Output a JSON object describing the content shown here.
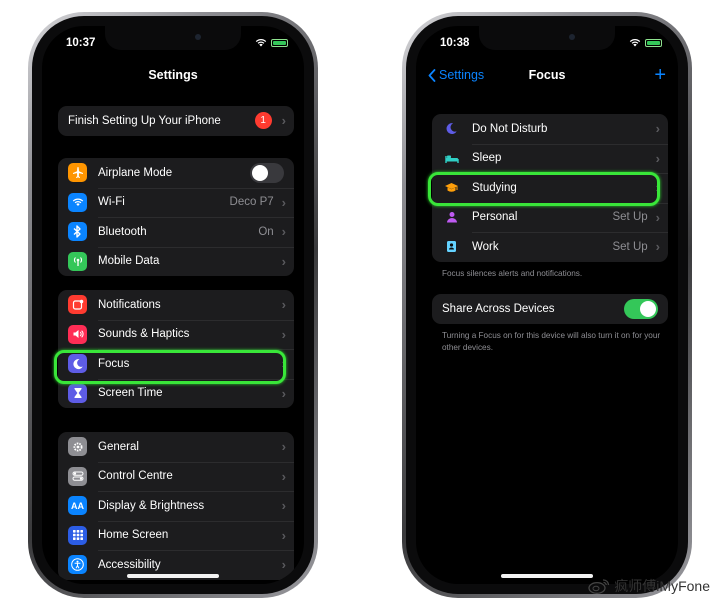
{
  "left_phone": {
    "time": "10:37",
    "title": "Settings",
    "setup": {
      "label": "Finish Setting Up Your iPhone",
      "badge": "1"
    },
    "group1": [
      {
        "name": "airplane",
        "label": "Airplane Mode",
        "icon": "airplane-icon",
        "color": "#ff9500",
        "toggle": false
      },
      {
        "name": "wifi",
        "label": "Wi-Fi",
        "value": "Deco P7",
        "icon": "wifi-icon",
        "color": "#0a84ff"
      },
      {
        "name": "bluetooth",
        "label": "Bluetooth",
        "value": "On",
        "icon": "bluetooth-icon",
        "color": "#0a84ff"
      },
      {
        "name": "mobile-data",
        "label": "Mobile Data",
        "icon": "antenna-icon",
        "color": "#34c759"
      }
    ],
    "group2": [
      {
        "name": "notifications",
        "label": "Notifications",
        "icon": "notifications-icon",
        "color": "#ff3b30"
      },
      {
        "name": "sounds",
        "label": "Sounds & Haptics",
        "icon": "speaker-icon",
        "color": "#ff2d55"
      },
      {
        "name": "focus",
        "label": "Focus",
        "icon": "moon-icon",
        "color": "#5e5ce6"
      },
      {
        "name": "screen-time",
        "label": "Screen Time",
        "icon": "hourglass-icon",
        "color": "#5e5ce6"
      }
    ],
    "group3": [
      {
        "name": "general",
        "label": "General",
        "icon": "gear-icon",
        "color": "#8e8e93"
      },
      {
        "name": "control-centre",
        "label": "Control Centre",
        "icon": "toggles-icon",
        "color": "#8e8e93"
      },
      {
        "name": "display",
        "label": "Display & Brightness",
        "icon": "aa-icon",
        "color": "#0a84ff"
      },
      {
        "name": "home-screen",
        "label": "Home Screen",
        "icon": "grid-icon",
        "color": "#2c5de5"
      },
      {
        "name": "accessibility",
        "label": "Accessibility",
        "icon": "accessibility-icon",
        "color": "#0a84ff"
      }
    ]
  },
  "right_phone": {
    "time": "10:38",
    "back_label": "Settings",
    "title": "Focus",
    "add_symbol": "+",
    "modes": [
      {
        "name": "do-not-disturb",
        "label": "Do Not Disturb",
        "icon": "moon-icon",
        "color": "#5e5ce6"
      },
      {
        "name": "sleep",
        "label": "Sleep",
        "icon": "bed-icon",
        "color": "#30d0c6"
      },
      {
        "name": "studying",
        "label": "Studying",
        "icon": "graduation-cap-icon",
        "color": "#ff9f0a"
      },
      {
        "name": "personal",
        "label": "Personal",
        "value": "Set Up",
        "icon": "person-icon",
        "color": "#bf5af2"
      },
      {
        "name": "work",
        "label": "Work",
        "value": "Set Up",
        "icon": "badge-icon",
        "color": "#64d2ff"
      }
    ],
    "modes_footnote": "Focus silences alerts and notifications.",
    "share_label": "Share Across Devices",
    "share_enabled": true,
    "share_footnote": "Turning a Focus on for this device will also turn it on for your other devices."
  },
  "watermark": "疯师傅iMyFone"
}
